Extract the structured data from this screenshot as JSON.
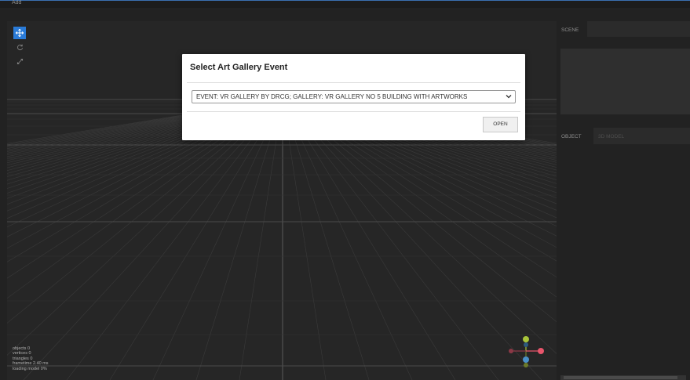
{
  "menubar": {
    "add_label": "Add"
  },
  "colors": {
    "accent": "#2a7bd8",
    "gizmo_x": "#e8556b",
    "gizmo_y": "#a8c43a",
    "gizmo_z": "#4a90c8"
  },
  "toolbar": {
    "tools": [
      {
        "icon": "move-icon",
        "active": true
      },
      {
        "icon": "rotate-icon",
        "active": false
      },
      {
        "icon": "scale-icon",
        "active": false
      }
    ]
  },
  "stats": {
    "objects_label": "objects",
    "objects_value": "0",
    "vertices_label": "vertices",
    "vertices_value": "0",
    "triangles_label": "triangles",
    "triangles_value": "0",
    "frametime_label": "frametime",
    "frametime_value": "2.40 ms",
    "loading_label": "loading model",
    "loading_value": "0%"
  },
  "sidebar": {
    "scene_label": "SCENE",
    "object_label": "OBJECT",
    "object_type": "3D MODEL"
  },
  "modal": {
    "title": "Select Art Gallery Event",
    "selected_event": "EVENT: VR GALLERY BY DRCG; GALLERY: VR GALLERY NO 5 BUILDING WITH ARTWORKS",
    "open_label": "OPEN"
  }
}
